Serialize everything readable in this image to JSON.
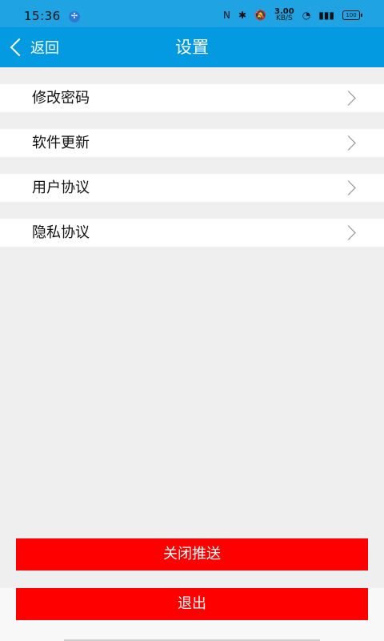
{
  "status_bar": {
    "time": "15:36",
    "app_badge": "✢",
    "network_speed_value": "3.00",
    "network_speed_unit": "KB/S",
    "battery_level": "100"
  },
  "header": {
    "back_label": "返回",
    "title": "设置"
  },
  "settings": {
    "items": [
      {
        "label": "修改密码"
      },
      {
        "label": "软件更新"
      },
      {
        "label": "用户协议"
      },
      {
        "label": "隐私协议"
      }
    ]
  },
  "actions": {
    "close_push_label": "关闭推送",
    "logout_label": "退出"
  },
  "colors": {
    "header": "#049ae2",
    "primary_button": "#ff0000",
    "background": "#efefef"
  }
}
